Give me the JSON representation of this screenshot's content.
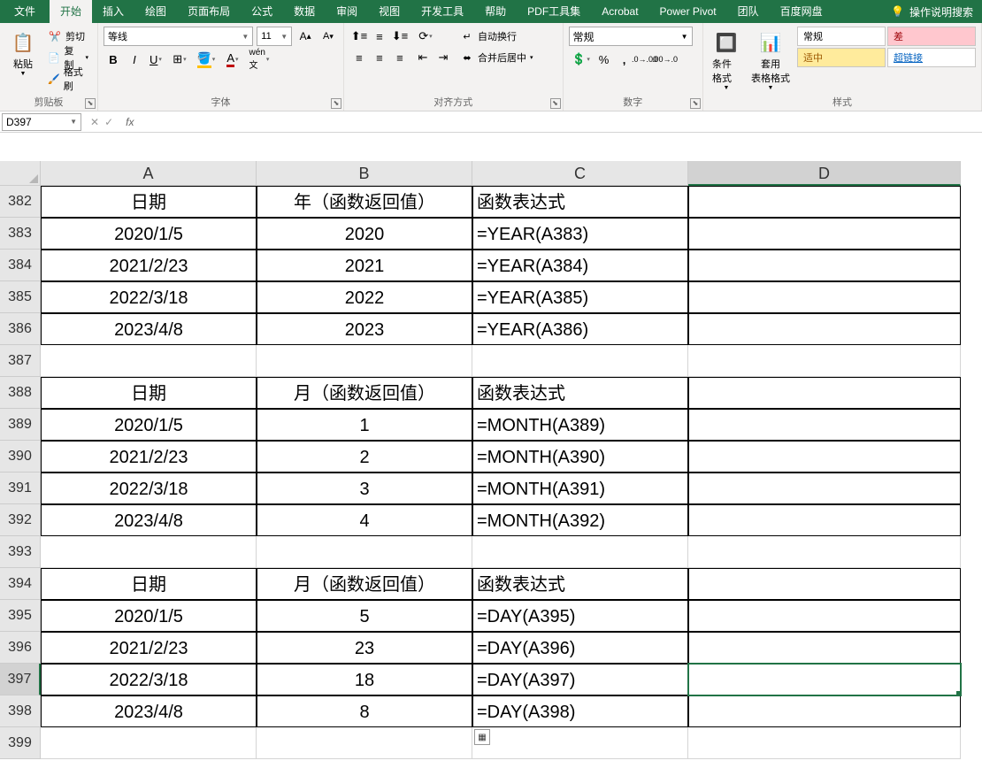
{
  "tabs": {
    "file": "文件",
    "home": "开始",
    "insert": "插入",
    "draw": "绘图",
    "layout": "页面布局",
    "formulas": "公式",
    "data": "数据",
    "review": "审阅",
    "view": "视图",
    "dev": "开发工具",
    "help": "帮助",
    "pdf": "PDF工具集",
    "acrobat": "Acrobat",
    "powerpivot": "Power Pivot",
    "team": "团队",
    "baidu": "百度网盘",
    "search": "操作说明搜索"
  },
  "clipboard": {
    "paste": "粘贴",
    "cut": "剪切",
    "copy": "复制",
    "format_painter": "格式刷",
    "label": "剪贴板"
  },
  "font": {
    "name": "等线",
    "size": "11",
    "label": "字体"
  },
  "align": {
    "wrap": "自动换行",
    "merge": "合并后居中",
    "label": "对齐方式"
  },
  "number": {
    "format": "常规",
    "label": "数字"
  },
  "styles": {
    "cond": "条件格式",
    "table": "套用\n表格格式",
    "normal": "常规",
    "bad": "差",
    "good": "适中",
    "link": "超链接",
    "label": "样式"
  },
  "namebox": "D397",
  "columns": [
    "A",
    "B",
    "C",
    "D"
  ],
  "rows": [
    {
      "n": "382",
      "a": "日期",
      "b": "年（函数返回值）",
      "c": "函数表达式",
      "d": "",
      "box": true
    },
    {
      "n": "383",
      "a": "2020/1/5",
      "b": "2020",
      "c": "=YEAR(A383)",
      "d": "",
      "box": true
    },
    {
      "n": "384",
      "a": "2021/2/23",
      "b": "2021",
      "c": "=YEAR(A384)",
      "d": "",
      "box": true
    },
    {
      "n": "385",
      "a": "2022/3/18",
      "b": "2022",
      "c": "=YEAR(A385)",
      "d": "",
      "box": true
    },
    {
      "n": "386",
      "a": "2023/4/8",
      "b": "2023",
      "c": "=YEAR(A386)",
      "d": "",
      "box": true
    },
    {
      "n": "387",
      "a": "",
      "b": "",
      "c": "",
      "d": "",
      "box": false
    },
    {
      "n": "388",
      "a": "日期",
      "b": "月（函数返回值）",
      "c": "函数表达式",
      "d": "",
      "box": true
    },
    {
      "n": "389",
      "a": "2020/1/5",
      "b": "1",
      "c": "=MONTH(A389)",
      "d": "",
      "box": true
    },
    {
      "n": "390",
      "a": "2021/2/23",
      "b": "2",
      "c": "=MONTH(A390)",
      "d": "",
      "box": true
    },
    {
      "n": "391",
      "a": "2022/3/18",
      "b": "3",
      "c": "=MONTH(A391)",
      "d": "",
      "box": true
    },
    {
      "n": "392",
      "a": "2023/4/8",
      "b": "4",
      "c": "=MONTH(A392)",
      "d": "",
      "box": true
    },
    {
      "n": "393",
      "a": "",
      "b": "",
      "c": "",
      "d": "",
      "box": false
    },
    {
      "n": "394",
      "a": "日期",
      "b": "月（函数返回值）",
      "c": "函数表达式",
      "d": "",
      "box": true
    },
    {
      "n": "395",
      "a": "2020/1/5",
      "b": "5",
      "c": "=DAY(A395)",
      "d": "",
      "box": true
    },
    {
      "n": "396",
      "a": "2021/2/23",
      "b": "23",
      "c": "=DAY(A396)",
      "d": "",
      "box": true
    },
    {
      "n": "397",
      "a": "2022/3/18",
      "b": "18",
      "c": "=DAY(A397)",
      "d": "",
      "box": true,
      "sel": true
    },
    {
      "n": "398",
      "a": "2023/4/8",
      "b": "8",
      "c": "=DAY(A398)",
      "d": "",
      "box": true
    },
    {
      "n": "399",
      "a": "",
      "b": "",
      "c": "",
      "d": "",
      "box": false
    }
  ]
}
